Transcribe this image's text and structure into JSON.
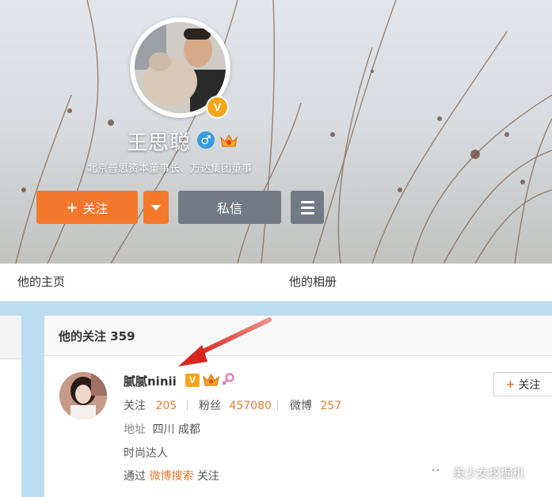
{
  "profile": {
    "name": "王思聪",
    "bio": "北京普思资本董事长、万达集团董事",
    "verified_badge": "V",
    "gender_symbol": "♂",
    "crown_icon": "crown-icon"
  },
  "actions": {
    "follow_label": "关注",
    "follow_plus": "+",
    "message_label": "私信"
  },
  "tabs": {
    "home": "他的主页",
    "album": "他的相册"
  },
  "following_section": {
    "title": "他的关注 359"
  },
  "user": {
    "name": "腻腻ninii",
    "verified_badge": "V",
    "stats": {
      "following_label": "关注",
      "following_value": "205",
      "fans_label": "粉丝",
      "fans_value": "457080",
      "weibo_label": "微博",
      "weibo_value": "257"
    },
    "address_label": "地址",
    "address_value": "四川 成都",
    "description": "时尚达人",
    "via_prefix": "通过",
    "via_link": "微博搜索",
    "via_suffix": "关注",
    "follow_button_plus": "+",
    "follow_button_label": "关注"
  },
  "watermark": "美少女挖掘机",
  "colors": {
    "accent_orange": "#f4782b",
    "button_gray": "#727a86",
    "verified_gold": "#f6a61b",
    "link_orange": "#e77c2f",
    "annotation_red": "#e23a2e",
    "panel_blue": "#bcdcf0"
  }
}
